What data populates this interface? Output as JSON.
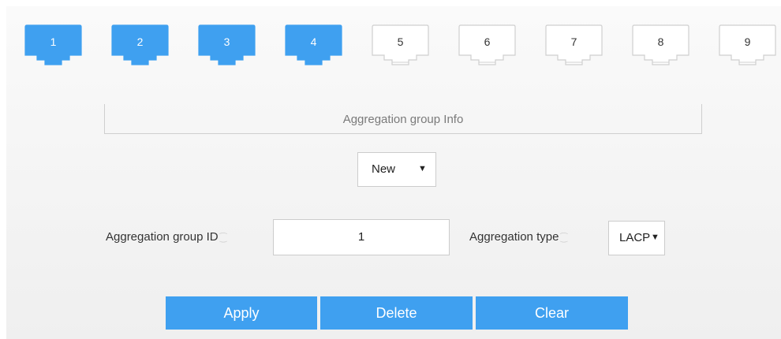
{
  "ports": [
    {
      "label": "1",
      "state": "active"
    },
    {
      "label": "2",
      "state": "active"
    },
    {
      "label": "3",
      "state": "active"
    },
    {
      "label": "4",
      "state": "active"
    },
    {
      "label": "5",
      "state": "inactive"
    },
    {
      "label": "6",
      "state": "inactive"
    },
    {
      "label": "7",
      "state": "inactive"
    },
    {
      "label": "8",
      "state": "inactive"
    },
    {
      "label": "9",
      "state": "inactive"
    }
  ],
  "colors": {
    "accent": "#3fa0f0",
    "port_active": "#3fa0f0",
    "port_inactive": "#ffffff"
  },
  "info": {
    "title": "Aggregation group Info"
  },
  "mode_select": {
    "value": "New"
  },
  "form": {
    "group_id_label": "Aggregation group ID",
    "group_id_value": "1",
    "type_label": "Aggregation type",
    "type_value": "LACP"
  },
  "buttons": {
    "apply": "Apply",
    "delete": "Delete",
    "clear": "Clear"
  }
}
